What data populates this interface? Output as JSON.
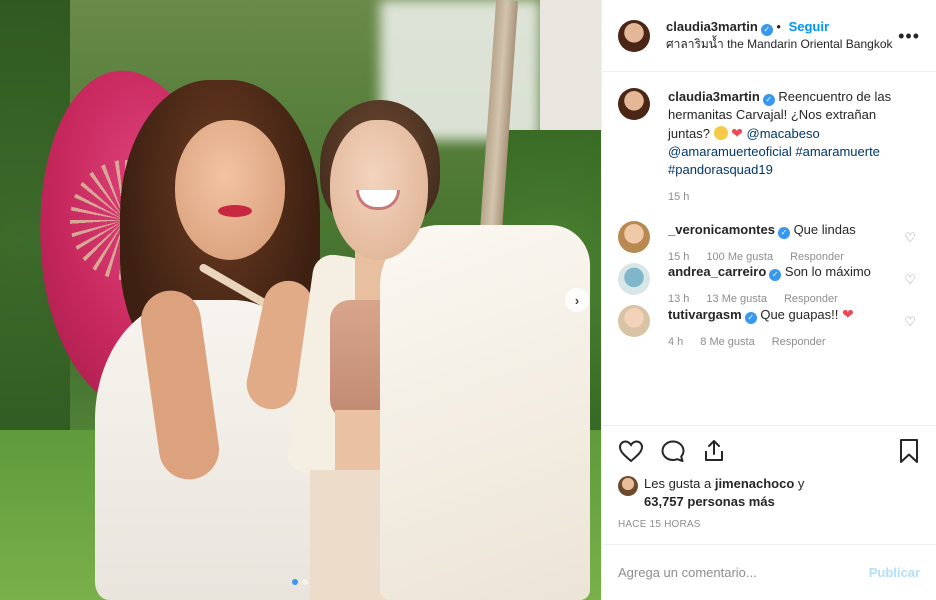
{
  "post": {
    "author": "claudia3martin",
    "follow_label": "Seguir",
    "separator": "•",
    "location": "ศาลาริมน้ำ the Mandarin Oriental Bangkok",
    "more_label": "•••",
    "next_label": "›"
  },
  "caption": {
    "username": "claudia3martin",
    "text_1": " Reencuentro de las hermanitas Carvajal! ¿Nos extrañan juntas? ",
    "tag_1": "@macabeso",
    "tag_2": "@amaramuerteoficial",
    "tag_3": "#amaramuerte",
    "tag_4": "#pandorasquad19",
    "time": "15 h"
  },
  "comments": [
    {
      "username": "_veronicamontes",
      "text": "Que lindas",
      "time": "15 h",
      "likes": "100 Me gusta",
      "reply": "Responder"
    },
    {
      "username": "andrea_carreiro",
      "text": "Son lo máximo",
      "time": "13 h",
      "likes": "13 Me gusta",
      "reply": "Responder"
    },
    {
      "username": "tutivargasm",
      "text": "Que guapas!! ",
      "time": "4 h",
      "likes": "8 Me gusta",
      "reply": "Responder"
    }
  ],
  "likes": {
    "prefix": "Les gusta a ",
    "user": "jimenachoco",
    "connector": " y",
    "count": "63,757 personas más"
  },
  "posted_ago": "HACE 15 HORAS",
  "comment_box": {
    "placeholder": "Agrega un comentario...",
    "publish_label": "Publicar"
  },
  "colors": {
    "verified": "#3897f0",
    "follow": "#0095f6",
    "publish_disabled": "#b2dffc",
    "heart": "#ed4956"
  },
  "carousel": {
    "current": 1,
    "total": 2
  }
}
